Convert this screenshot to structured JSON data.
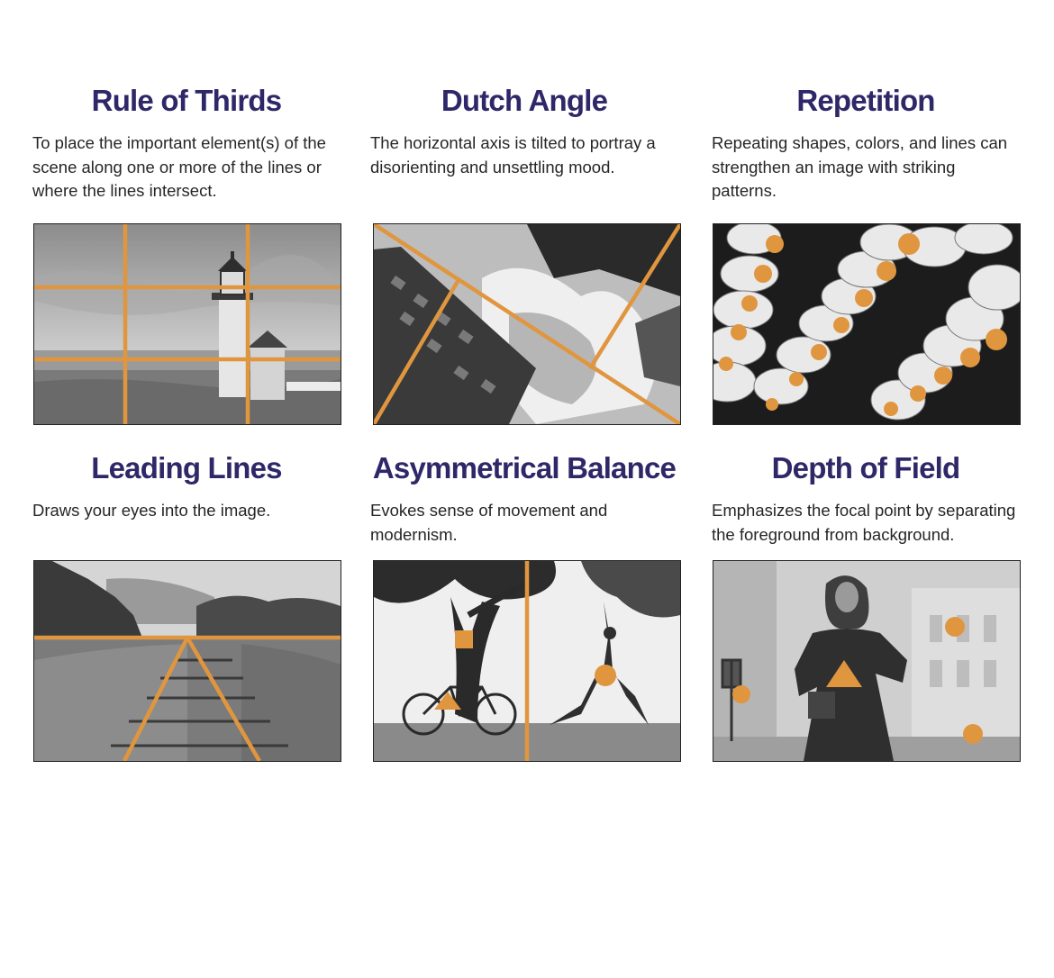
{
  "accent_color": "#e0963f",
  "title_color": "#2e2768",
  "cards": [
    {
      "title": "Rule of Thirds",
      "description": "To place the important element(s) of the scene along one or more of the lines or where the lines intersect.",
      "image": "lighthouse-photo"
    },
    {
      "title": "Dutch Angle",
      "description": "The horizontal axis is tilted to portray a disorienting and unsettling mood.",
      "image": "tilted-buildings-photo"
    },
    {
      "title": "Repetition",
      "description": "Repeating shapes, colors, and lines can strengthen an image with striking patterns.",
      "image": "paper-lanterns-photo"
    },
    {
      "title": "Leading Lines",
      "description": "Draws your eyes into the image.",
      "image": "railroad-tracks-photo"
    },
    {
      "title": "Asymmetrical Balance",
      "description": "Evokes sense of movement and modernism.",
      "image": "tree-bicycle-yoga-photo"
    },
    {
      "title": "Depth of Field",
      "description": "Emphasizes the focal point by separating the foreground from background.",
      "image": "woman-street-photo"
    }
  ]
}
